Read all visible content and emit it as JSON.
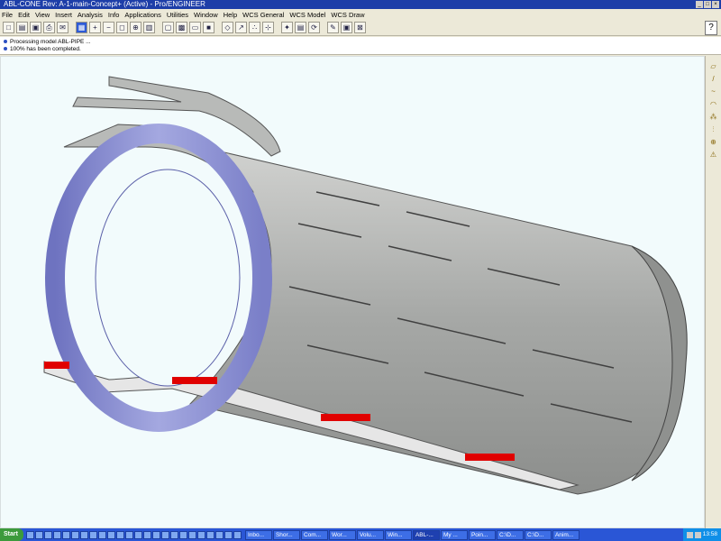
{
  "window": {
    "title": "ABL-CONE Rev: A-1-main-Concept+ (Active) - Pro/ENGINEER",
    "controls": [
      "_",
      "□",
      "×"
    ]
  },
  "menu": [
    "File",
    "Edit",
    "View",
    "Insert",
    "Analysis",
    "Info",
    "Applications",
    "Utilities",
    "Window",
    "Help",
    "WCS General",
    "WCS Model",
    "WCS Draw"
  ],
  "toolbar": {
    "buttons": [
      "new-icon",
      "open-icon",
      "save-icon",
      "print-icon",
      "email-icon",
      "separator",
      "repaint-icon",
      "zoom-in-icon",
      "zoom-out-icon",
      "refit-icon",
      "orient-icon",
      "view-manager-icon",
      "separator",
      "wireframe-icon",
      "hidden-line-icon",
      "no-hidden-icon",
      "shading-icon",
      "separator",
      "datum-plane-icon",
      "datum-axis-icon",
      "datum-point-icon",
      "csys-icon",
      "separator",
      "spin-center-icon",
      "select-icon",
      "model-tree-icon",
      "separator",
      "pencil-icon",
      "window-icon",
      "close-window-icon"
    ],
    "right_icon": "help-icon"
  },
  "messages": [
    "Processing model ABL-PIPE ...",
    "100% has been completed."
  ],
  "rightbar": [
    "sketch-icon",
    "line-icon",
    "curve-icon",
    "round-icon",
    "pattern-icon",
    "mirror-icon",
    "csys-icon",
    "warning-icon"
  ],
  "taskbar": {
    "start": "Start",
    "quicklaunch_count": 24,
    "tasks": [
      "Inbo...",
      "Shor...",
      "Com...",
      "Wor...",
      "Volu...",
      "Win...",
      "ABL-...",
      "My ...",
      "Poin...",
      "C:\\D...",
      "C:\\D...",
      "Anim..."
    ],
    "active_task": 6,
    "clock": "13:58"
  },
  "colors": {
    "viewport_bg": "#f2fbfc",
    "pipe_gray": "#a9aba9",
    "ring_blue": "#8d92d4",
    "accent_red": "#e00000",
    "title_blue": "#1d3ea8"
  }
}
